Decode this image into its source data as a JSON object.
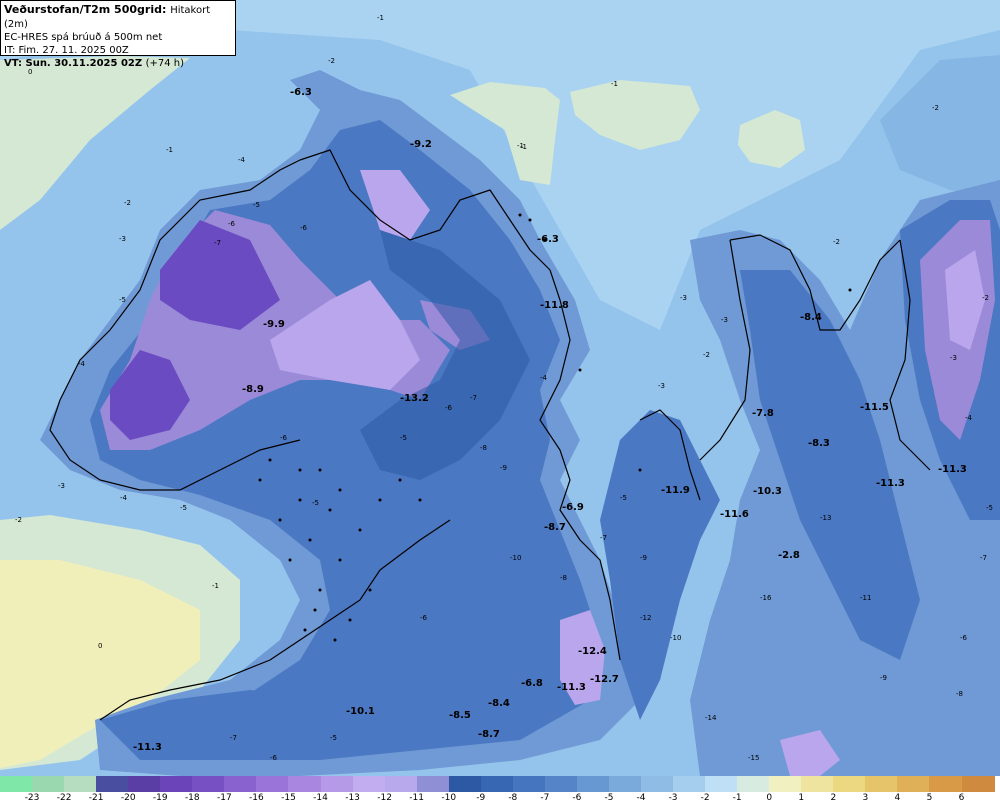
{
  "header": {
    "title_bold": "Veðurstofan/T2m 500grid:",
    "title_rest": "Hitakort (2m)",
    "model_line": "EC-HRES spá brúuð á 500m net",
    "init_line": "IT: Fim. 27. 11. 2025 00Z",
    "valid_bold": "VT: Sun. 30.11.2025 02Z",
    "valid_rest": "(+74 h)"
  },
  "colors": {
    "sea_light": "#a9d3f1",
    "sea_mid": "#86b6e4",
    "land_light": "#6f9ad5",
    "land_mid": "#4b78c2",
    "land_dark": "#2e5aa6",
    "cold_1": "#9b8ad8",
    "cold_2": "#b9a6ec",
    "cold_3": "#6a4bc2",
    "ice_green": "#d5e8d4",
    "warm_yellow": "#f0efba",
    "coast": "#000000"
  },
  "map_labels": [
    {
      "text": "-9.2"
    },
    {
      "text": "-6.3"
    },
    {
      "text": "-11.8"
    },
    {
      "text": "-9.9"
    },
    {
      "text": "-8.9"
    },
    {
      "text": "-13.2"
    },
    {
      "text": "-8.4"
    },
    {
      "text": "-7.8"
    },
    {
      "text": "-11.5"
    },
    {
      "text": "-8.3"
    },
    {
      "text": "-11.3"
    },
    {
      "text": "-11.3"
    },
    {
      "text": "-11.9"
    },
    {
      "text": "-10.3"
    },
    {
      "text": "-11.6"
    },
    {
      "text": "-6.9"
    },
    {
      "text": "-8.7"
    },
    {
      "text": "-2.8"
    },
    {
      "text": "-12.4"
    },
    {
      "text": "-12.7"
    },
    {
      "text": "-11.3"
    },
    {
      "text": "-6.8"
    },
    {
      "text": "-10.1"
    },
    {
      "text": "-8.5"
    },
    {
      "text": "-8.4"
    },
    {
      "text": "-8.7"
    },
    {
      "text": "-11.3"
    },
    {
      "text": "-6.3"
    }
  ],
  "contour_labels": [
    {
      "text": "-1"
    },
    {
      "text": "-2"
    },
    {
      "text": "-1"
    },
    {
      "text": "-1"
    },
    {
      "text": "-2"
    },
    {
      "text": "0"
    },
    {
      "text": "-1"
    },
    {
      "text": "-2"
    },
    {
      "text": "-3"
    },
    {
      "text": "-5"
    },
    {
      "text": "-4"
    },
    {
      "text": "-3"
    },
    {
      "text": "-2"
    },
    {
      "text": "-1"
    },
    {
      "text": "-1"
    },
    {
      "text": "0"
    },
    {
      "text": "-2"
    },
    {
      "text": "-3"
    },
    {
      "text": "-2"
    },
    {
      "text": "-3"
    },
    {
      "text": "-4"
    },
    {
      "text": "-5"
    },
    {
      "text": "-6"
    },
    {
      "text": "-7"
    },
    {
      "text": "-6"
    },
    {
      "text": "-4"
    },
    {
      "text": "-5"
    },
    {
      "text": "-6"
    },
    {
      "text": "-5"
    },
    {
      "text": "-7"
    },
    {
      "text": "-8"
    },
    {
      "text": "-9"
    },
    {
      "text": "-10"
    },
    {
      "text": "-12"
    },
    {
      "text": "-14"
    },
    {
      "text": "-15"
    },
    {
      "text": "-16"
    },
    {
      "text": "-13"
    },
    {
      "text": "-11"
    },
    {
      "text": "-9"
    },
    {
      "text": "-8"
    },
    {
      "text": "-7"
    },
    {
      "text": "-6"
    },
    {
      "text": "-5"
    },
    {
      "text": "-4"
    },
    {
      "text": "-3"
    },
    {
      "text": "-2"
    },
    {
      "text": "-5"
    },
    {
      "text": "-6"
    },
    {
      "text": "-7"
    },
    {
      "text": "-8"
    },
    {
      "text": "-9"
    },
    {
      "text": "-10"
    },
    {
      "text": "-6"
    },
    {
      "text": "-5"
    },
    {
      "text": "-4"
    },
    {
      "text": "-3"
    },
    {
      "text": "-5"
    },
    {
      "text": "-6"
    },
    {
      "text": "-7"
    }
  ],
  "legend": {
    "values": [
      "-23",
      "-22",
      "-21",
      "-20",
      "-19",
      "-18",
      "-17",
      "-16",
      "-15",
      "-14",
      "-13",
      "-12",
      "-11",
      "-10",
      "-9",
      "-8",
      "-7",
      "-6",
      "-5",
      "-4",
      "-3",
      "-2",
      "-1",
      "0",
      "1",
      "2",
      "3",
      "4",
      "5",
      "6"
    ],
    "colors": [
      "#7fe8a8",
      "#9ad9b0",
      "#b6ddc0",
      "#4a4ea0",
      "#5a3ea6",
      "#6a44b8",
      "#7750c4",
      "#8a62cf",
      "#9a74d8",
      "#a987e0",
      "#b59ae8",
      "#c2adf0",
      "#b8a8ec",
      "#8f8fd6",
      "#2d58a4",
      "#3766b2",
      "#4575be",
      "#5585c8",
      "#6798d2",
      "#7aaadb",
      "#8fbce4",
      "#a4cdee",
      "#bfdff6",
      "#d7ebe0",
      "#f1f0c0",
      "#eee4a0",
      "#ebd880",
      "#e6c56a",
      "#e0b058",
      "#d99a48",
      "#d08a40"
    ]
  }
}
